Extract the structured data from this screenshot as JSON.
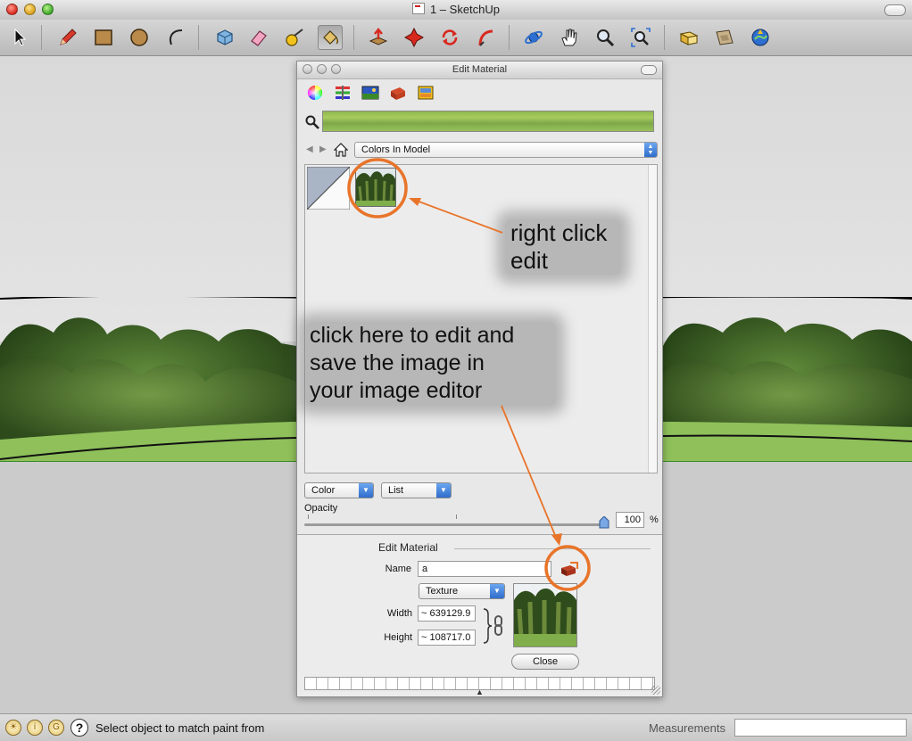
{
  "window": {
    "title": "1 – SketchUp"
  },
  "toolbar": {
    "tools": [
      "select-icon",
      "pencil-icon",
      "rectangle-icon",
      "circle-icon",
      "arc-icon",
      "make-component-icon",
      "eraser-icon",
      "tape-measure-icon",
      "paint-bucket-icon",
      "push-pull-icon",
      "move-icon",
      "rotate-icon",
      "follow-me-icon",
      "orbit-icon",
      "pan-icon",
      "zoom-icon",
      "zoom-extents-icon",
      "get-models-icon",
      "share-model-icon",
      "google-earth-icon"
    ],
    "active_tool": "paint-bucket-icon"
  },
  "material_panel": {
    "title": "Edit Material",
    "tabs": [
      "color-wheel-icon",
      "color-sliders-icon",
      "image-color-icon",
      "crayons-icon",
      "texture-palette-icon"
    ],
    "collection": "Colors In Model",
    "display_mode": "Color",
    "view_mode": "List",
    "opacity_label": "Opacity",
    "opacity_value": "100",
    "opacity_unit": "%",
    "opacity_fraction": 1.0,
    "edit": {
      "heading": "Edit Material",
      "name_label": "Name",
      "name_value": "a",
      "texture_mode": "Texture",
      "width_label": "Width",
      "width_value": "~ 639129.9",
      "height_label": "Height",
      "height_value": "~ 108717.0",
      "close_label": "Close"
    }
  },
  "annotations": {
    "right_click": "right click edit",
    "right_click_lines": [
      "right click",
      "edit"
    ],
    "edit_image_lines": [
      "click here to edit and",
      "save the image in",
      "your image editor"
    ],
    "color": "#e8742a"
  },
  "statusbar": {
    "message": "Select object to match paint from",
    "measurements_label": "Measurements",
    "help_label": "?"
  }
}
